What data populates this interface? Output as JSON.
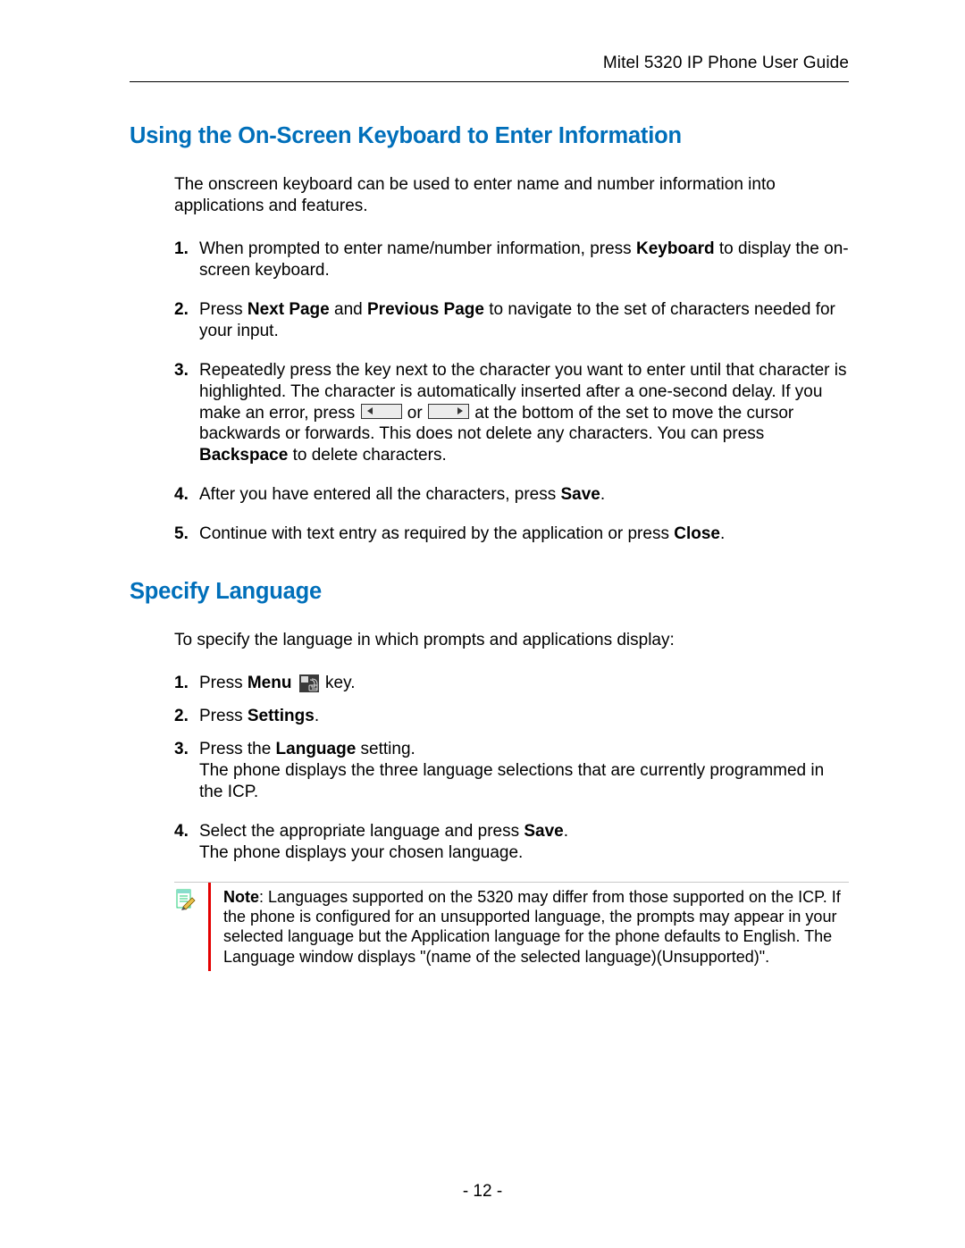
{
  "header": {
    "title": "Mitel 5320 IP Phone User Guide"
  },
  "section1": {
    "heading": "Using the On-Screen Keyboard to Enter Information",
    "intro": "The onscreen keyboard can be used to enter name and number information into applications and features.",
    "steps": {
      "s1a": "When prompted to enter name/number information, press ",
      "s1b": "Keyboard",
      "s1c": " to display the on-screen keyboard.",
      "s2a": "Press ",
      "s2b": "Next Page",
      "s2c": " and ",
      "s2d": "Previous Page",
      "s2e": " to navigate to the set of characters needed for your input.",
      "s3a": "Repeatedly press the key next to the character you want to enter until that character is highlighted. The character is automatically inserted after a one-second delay. If you make an error, press ",
      "s3b": " or ",
      "s3c": " at the bottom of the set to move the cursor backwards or forwards. This does not delete any characters. You can press ",
      "s3d": "Backspace",
      "s3e": " to delete characters.",
      "s4a": "After you have entered all the characters, press ",
      "s4b": "Save",
      "s4c": ".",
      "s5a": "Continue with text entry as required by the application or press ",
      "s5b": "Close",
      "s5c": "."
    }
  },
  "section2": {
    "heading": "Specify Language",
    "intro": "To specify the language in which prompts and applications display:",
    "steps": {
      "s1a": "Press ",
      "s1b": "Menu",
      "s1c": " key.",
      "s2a": "Press ",
      "s2b": "Settings",
      "s2c": ".",
      "s3a": "Press the ",
      "s3b": "Language",
      "s3c": " setting.",
      "s3d": "The phone displays the three language selections that are currently programmed in the ICP.",
      "s4a": "Select the appropriate language and press ",
      "s4b": "Save",
      "s4c": ".",
      "s4d": "The phone displays your chosen language."
    },
    "note": {
      "label": "Note",
      "body": ": Languages supported on the 5320 may differ from those supported on the ICP. If the phone is configured for an unsupported language, the prompts may appear in your selected language but the Application language for the phone defaults to English. The Language window displays \"(name of the selected language)(Unsupported)\"."
    }
  },
  "colors": {
    "headingBlue": "#006FBA",
    "noteRed": "#e40000"
  },
  "footer": {
    "pagenum": "- 12 -"
  }
}
